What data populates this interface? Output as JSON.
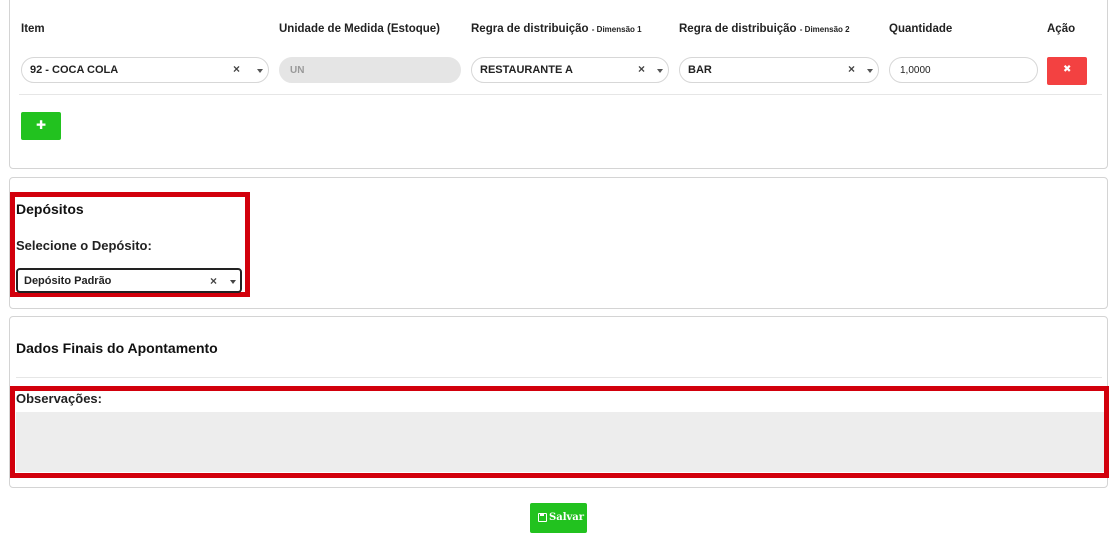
{
  "items_table": {
    "headers": {
      "item": "Item",
      "unidade": "Unidade de Medida (Estoque)",
      "regra1": "Regra de distribuição",
      "regra1_sub": "- Dimensão 1",
      "regra2": "Regra de distribuição",
      "regra2_sub": "- Dimensão 2",
      "quantidade": "Quantidade",
      "acao": "Ação"
    },
    "row": {
      "item": "92 - COCA COLA",
      "unidade": "UN",
      "regra1": "RESTAURANTE A",
      "regra2": "BAR",
      "quantidade": "1,0000",
      "remove_icon": "✖"
    },
    "add_icon": "✚",
    "clear_icon": "×"
  },
  "depositos": {
    "title": "Depósitos",
    "label": "Selecione o Depósito:",
    "selected": "Depósito Padrão",
    "clear_icon": "×"
  },
  "final": {
    "title": "Dados Finais do Apontamento",
    "obs_label": "Observações:",
    "obs_value": ""
  },
  "save_button": {
    "label": "Salvar",
    "icon": "save-icon",
    "color": "#22c21f"
  },
  "colors": {
    "danger": "#f34141",
    "success": "#22c21f",
    "highlight": "#d2000c"
  }
}
